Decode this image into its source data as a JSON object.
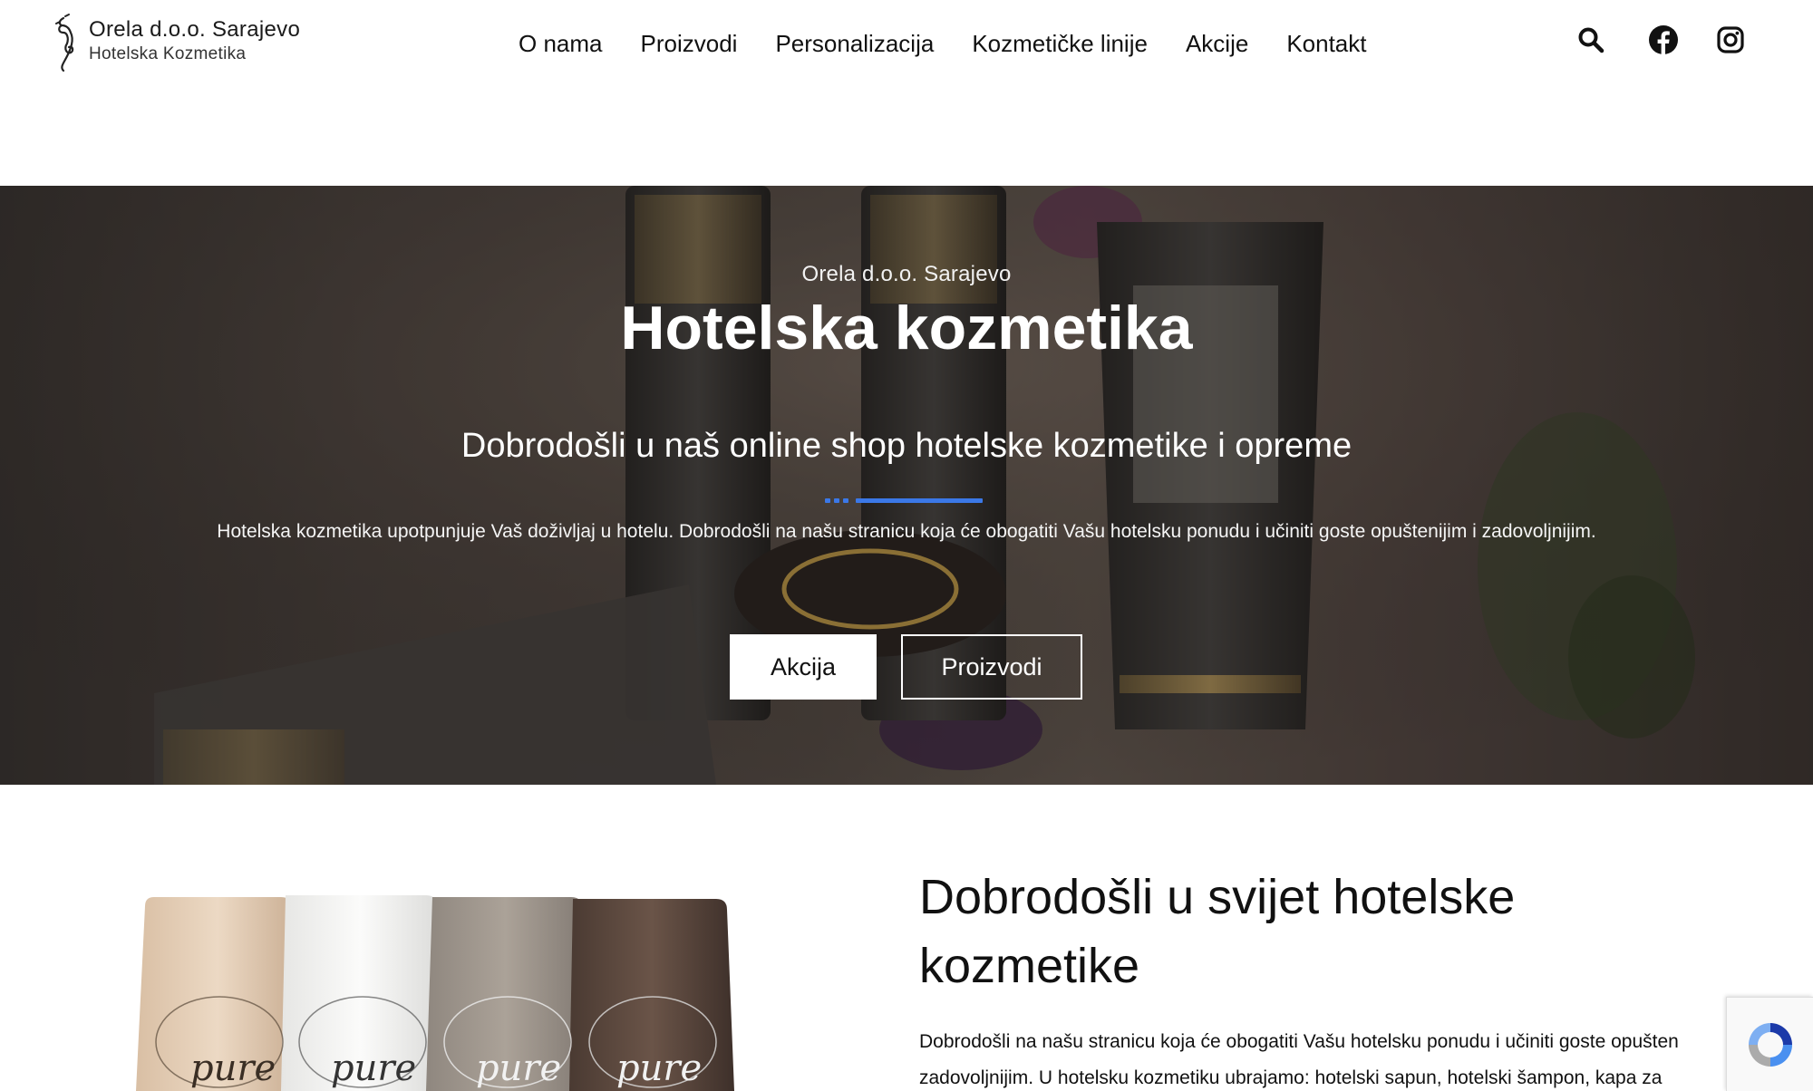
{
  "header": {
    "brand": "Orela d.o.o. Sarajevo",
    "tagline": "Hotelska Kozmetika",
    "nav": [
      {
        "label": "O nama"
      },
      {
        "label": "Proizvodi"
      },
      {
        "label": "Personalizacija"
      },
      {
        "label": "Kozmetičke linije"
      },
      {
        "label": "Akcije"
      },
      {
        "label": "Kontakt"
      }
    ],
    "icons": [
      "search-icon",
      "facebook-icon",
      "instagram-icon"
    ]
  },
  "hero": {
    "eyebrow": "Orela d.o.o. Sarajevo",
    "title": "Hotelska kozmetika",
    "subtitle": "Dobrodošli u naš online shop hotelske kozmetike i opreme",
    "description": "Hotelska kozmetika upotpunjuje Vaš doživljaj u hotelu. Dobrodošli na našu stranicu koja će obogatiti Vašu hotelsku ponudu i učiniti goste opuštenijim i zadovoljnijim.",
    "primary_button": "Akcija",
    "secondary_button": "Proizvodi",
    "accent_color": "#3b78e7"
  },
  "welcome": {
    "title": "Dobrodošli u svijet hotelske kozmetike",
    "text_line1": "Dobrodošli na našu stranicu koja će obogatiti Vašu hotelsku ponudu i učiniti goste opušten",
    "text_line2": "zadovoljnijim. U hotelsku kozmetiku ubrajamo: hotelski sapun, hotelski šampon, kapa za",
    "tube_label": "pure"
  }
}
